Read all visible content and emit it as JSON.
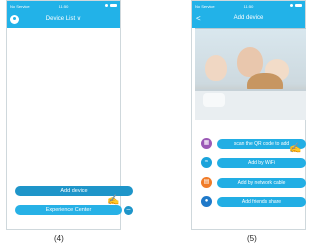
{
  "screen4": {
    "status": {
      "carrier": "No Service",
      "time": "11:50"
    },
    "nav": {
      "title": "Device List ∨"
    },
    "buttons": {
      "add": "Add device",
      "experience": "Experience Center"
    },
    "caption": "(4)"
  },
  "screen5": {
    "status": {
      "carrier": "No Service",
      "time": "11:50"
    },
    "nav": {
      "back": "<",
      "title": "Add device"
    },
    "options": [
      {
        "icon": "qr-code-icon",
        "label": "scan the QR code to add"
      },
      {
        "icon": "wifi-icon",
        "label": "Add by WiFi"
      },
      {
        "icon": "network-cable-icon",
        "label": "Add by network cable"
      },
      {
        "icon": "friends-share-icon",
        "label": "Add friends share"
      }
    ],
    "caption": "(5)"
  },
  "colors": {
    "primary": "#22b2e8",
    "button": "#1e95c9",
    "annotation": "#d43a3a"
  }
}
